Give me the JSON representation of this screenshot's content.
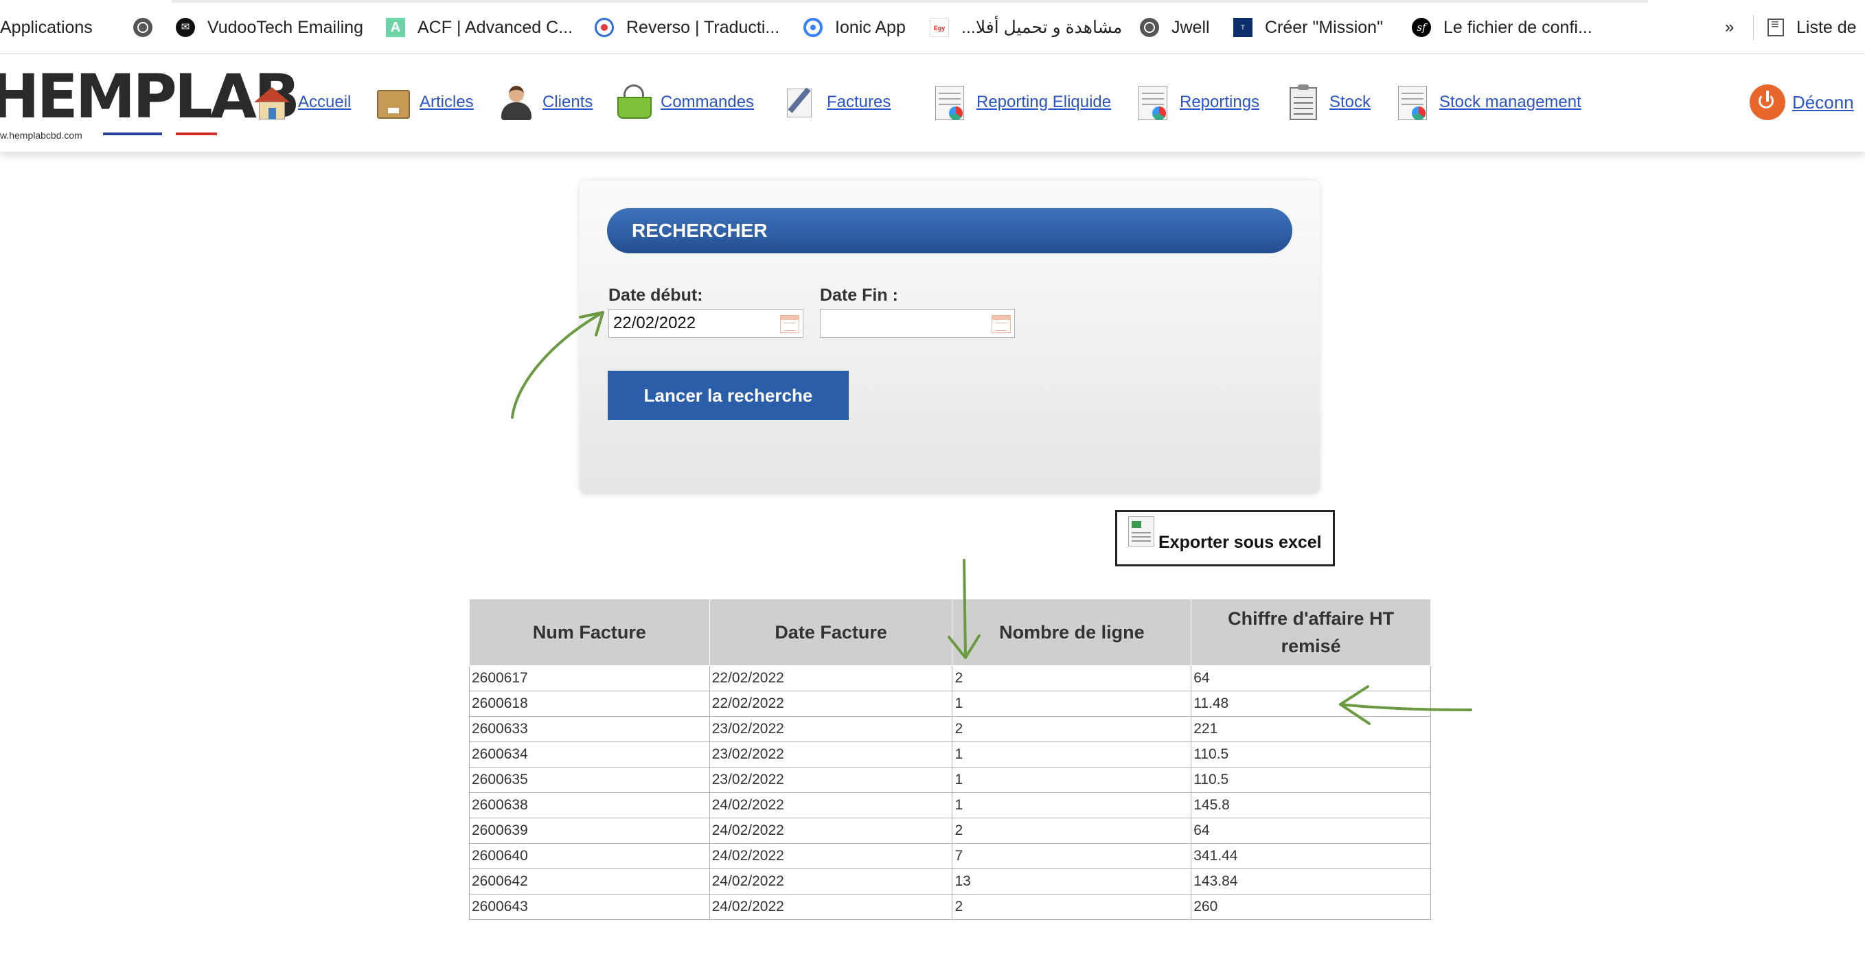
{
  "bookmarks": {
    "items": [
      {
        "label": "Applications",
        "icon": "apps-grid-icon"
      },
      {
        "label": "",
        "icon": "globe-icon"
      },
      {
        "label": "VudooTech Emailing",
        "icon": "vudootech-icon"
      },
      {
        "label": "ACF | Advanced C...",
        "icon": "acf-icon"
      },
      {
        "label": "Reverso | Traducti...",
        "icon": "reverso-icon"
      },
      {
        "label": "Ionic App",
        "icon": "ionic-icon"
      },
      {
        "label": "مشاهدة و تحميل أفلا...",
        "icon": "egybest-icon"
      },
      {
        "label": "Jwell",
        "icon": "globe-icon"
      },
      {
        "label": "Créer \"Mission\"",
        "icon": "trello-icon"
      },
      {
        "label": "Le fichier de confi...",
        "icon": "symfony-icon"
      }
    ],
    "overflow": "»",
    "reading_list": "Liste de"
  },
  "app": {
    "logo_text": "HEMPLAB",
    "logo_url": "w.hemplabcbd.com",
    "brand_colors": {
      "blue": "#2a3e9a",
      "red": "#d52b2b"
    }
  },
  "nav": {
    "items": [
      {
        "label": "Accueil",
        "icon": "house-icon"
      },
      {
        "label": "Articles",
        "icon": "box-icon"
      },
      {
        "label": "Clients",
        "icon": "person-icon"
      },
      {
        "label": "Commandes",
        "icon": "basket-icon"
      },
      {
        "label": "Factures",
        "icon": "pen-paper-icon"
      },
      {
        "label": "Reporting Eliquide",
        "icon": "report-chart-icon"
      },
      {
        "label": "Reportings",
        "icon": "report-chart-icon"
      },
      {
        "label": "Stock",
        "icon": "clipboard-icon"
      },
      {
        "label": "Stock management",
        "icon": "report-chart-icon"
      }
    ],
    "logout_label": "Déconn",
    "logout_icon": "power-icon"
  },
  "search": {
    "title": "RECHERCHER",
    "date_debut_label": "Date début:",
    "date_debut_value": "22/02/2022",
    "date_fin_label": "Date Fin :",
    "date_fin_value": "",
    "submit_label": "Lancer la recherche",
    "accent_color": "#2a5ea8"
  },
  "export": {
    "label": "Exporter sous excel",
    "icon": "spreadsheet-icon"
  },
  "table": {
    "headers": [
      "Num Facture",
      "Date Facture",
      "Nombre de ligne",
      "Chiffre d'affaire HT remisé"
    ],
    "rows": [
      [
        "2600617",
        "22/02/2022",
        "2",
        "64"
      ],
      [
        "2600618",
        "22/02/2022",
        "1",
        "11.48"
      ],
      [
        "2600633",
        "23/02/2022",
        "2",
        "221"
      ],
      [
        "2600634",
        "23/02/2022",
        "1",
        "110.5"
      ],
      [
        "2600635",
        "23/02/2022",
        "1",
        "110.5"
      ],
      [
        "2600638",
        "24/02/2022",
        "1",
        "145.8"
      ],
      [
        "2600639",
        "24/02/2022",
        "2",
        "64"
      ],
      [
        "2600640",
        "24/02/2022",
        "7",
        "341.44"
      ],
      [
        "2600642",
        "24/02/2022",
        "13",
        "143.84"
      ],
      [
        "2600643",
        "24/02/2022",
        "2",
        "260"
      ]
    ]
  },
  "annotations": {
    "arrow_color": "#6b9a43"
  }
}
